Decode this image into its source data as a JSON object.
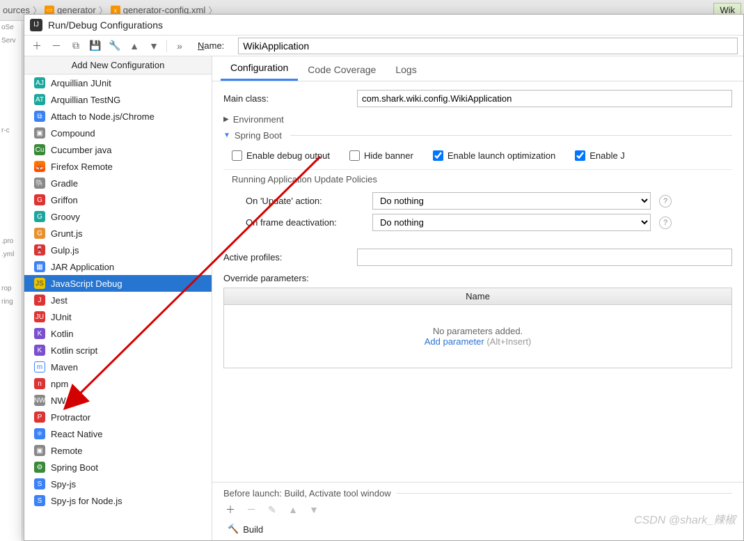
{
  "breadcrumb": {
    "item1": "ources",
    "item2": "generator",
    "item3": "generator-config.xml",
    "right_tab": "Wik"
  },
  "left_strip": {
    "l1": "oSe",
    "l2": "Serv",
    "l3": "r-c",
    "l4": ".pro",
    "l5": ".yml",
    "l6": "rop",
    "l7": "ring"
  },
  "dialog": {
    "title": "Run/Debug Configurations",
    "name_label_prefix": "N",
    "name_label_rest": "ame:",
    "name_value": "WikiApplication",
    "sidebar_header": "Add New Configuration",
    "config_types": [
      {
        "label": "Arquillian JUnit",
        "icon": "AJ",
        "cls": "ic-teal"
      },
      {
        "label": "Arquillian TestNG",
        "icon": "AT",
        "cls": "ic-teal"
      },
      {
        "label": "Attach to Node.js/Chrome",
        "icon": "⧉",
        "cls": "ic-blue"
      },
      {
        "label": "Compound",
        "icon": "▣",
        "cls": "ic-gray"
      },
      {
        "label": "Cucumber java",
        "icon": "Cu",
        "cls": "ic-green"
      },
      {
        "label": "Firefox Remote",
        "icon": "🦊",
        "cls": "ic-firefox"
      },
      {
        "label": "Gradle",
        "icon": "🐘",
        "cls": "ic-gray"
      },
      {
        "label": "Griffon",
        "icon": "G",
        "cls": "ic-red"
      },
      {
        "label": "Groovy",
        "icon": "G",
        "cls": "ic-teal"
      },
      {
        "label": "Grunt.js",
        "icon": "G",
        "cls": "ic-orange"
      },
      {
        "label": "Gulp.js",
        "icon": "🍷",
        "cls": "ic-red"
      },
      {
        "label": "JAR Application",
        "icon": "▦",
        "cls": "ic-blue"
      },
      {
        "label": "JavaScript Debug",
        "icon": "JS",
        "cls": "ic-js",
        "selected": true
      },
      {
        "label": "Jest",
        "icon": "J",
        "cls": "ic-red"
      },
      {
        "label": "JUnit",
        "icon": "JU",
        "cls": "ic-red"
      },
      {
        "label": "Kotlin",
        "icon": "K",
        "cls": "ic-purple"
      },
      {
        "label": "Kotlin script",
        "icon": "K",
        "cls": "ic-purple"
      },
      {
        "label": "Maven",
        "icon": "m",
        "cls": "ic-maven"
      },
      {
        "label": "npm",
        "icon": "n",
        "cls": "ic-red"
      },
      {
        "label": "NW.js",
        "icon": "NW",
        "cls": "ic-gray"
      },
      {
        "label": "Protractor",
        "icon": "P",
        "cls": "ic-red"
      },
      {
        "label": "React Native",
        "icon": "⚛",
        "cls": "ic-blue"
      },
      {
        "label": "Remote",
        "icon": "▣",
        "cls": "ic-gray"
      },
      {
        "label": "Spring Boot",
        "icon": "⚙",
        "cls": "ic-green"
      },
      {
        "label": "Spy-js",
        "icon": "S",
        "cls": "ic-blue"
      },
      {
        "label": "Spy-js for Node.js",
        "icon": "S",
        "cls": "ic-blue"
      }
    ],
    "tabs": [
      {
        "label": "Configuration",
        "active": true
      },
      {
        "label": "Code Coverage"
      },
      {
        "label": "Logs"
      }
    ],
    "main_class_label": "Main class:",
    "main_class_value": "com.shark.wiki.config.WikiApplication",
    "environment_label": "Environment",
    "spring_boot_label": "Spring Boot",
    "checkboxes": {
      "debug": "Enable debug output",
      "hide_banner": "Hide banner",
      "launch_opt": "Enable launch optimization",
      "enable_j": "Enable J"
    },
    "policies_header": "Running Application Update Policies",
    "policy1_label": "On 'Update' action:",
    "policy1_value": "Do nothing",
    "policy2_label": "On frame deactivation:",
    "policy2_value": "Do nothing",
    "active_profiles_label": "Active profiles:",
    "override_params_label": "Override parameters:",
    "param_header": "Name",
    "param_empty": "No parameters added.",
    "add_param_link": "Add parameter",
    "add_param_shortcut": " (Alt+Insert)",
    "before_launch_label": "Before launch: Build, Activate tool window",
    "build_item": "Build"
  },
  "watermark": "CSDN @shark_辣椒"
}
